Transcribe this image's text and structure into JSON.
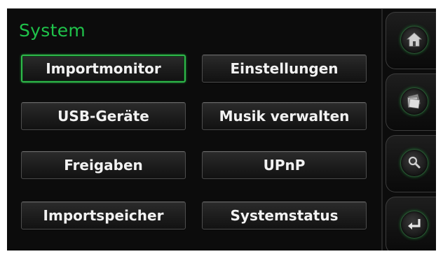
{
  "screen": {
    "title": "System"
  },
  "menu": {
    "items": [
      {
        "label": "Importmonitor",
        "selected": true
      },
      {
        "label": "Einstellungen",
        "selected": false
      },
      {
        "label": "USB-Geräte",
        "selected": false
      },
      {
        "label": "Musik verwalten",
        "selected": false
      },
      {
        "label": "Freigaben",
        "selected": false
      },
      {
        "label": "UPnP",
        "selected": false
      },
      {
        "label": "Importspeicher",
        "selected": false
      },
      {
        "label": "Systemstatus",
        "selected": false
      }
    ]
  },
  "sidebar": {
    "buttons": [
      {
        "icon": "home-icon"
      },
      {
        "icon": "cover-art-icon"
      },
      {
        "icon": "search-icon"
      },
      {
        "icon": "back-arrow-icon"
      }
    ]
  },
  "colors": {
    "accent": "#1fc24a",
    "background": "#0c0c0c",
    "button_text": "#f2f2f2"
  }
}
